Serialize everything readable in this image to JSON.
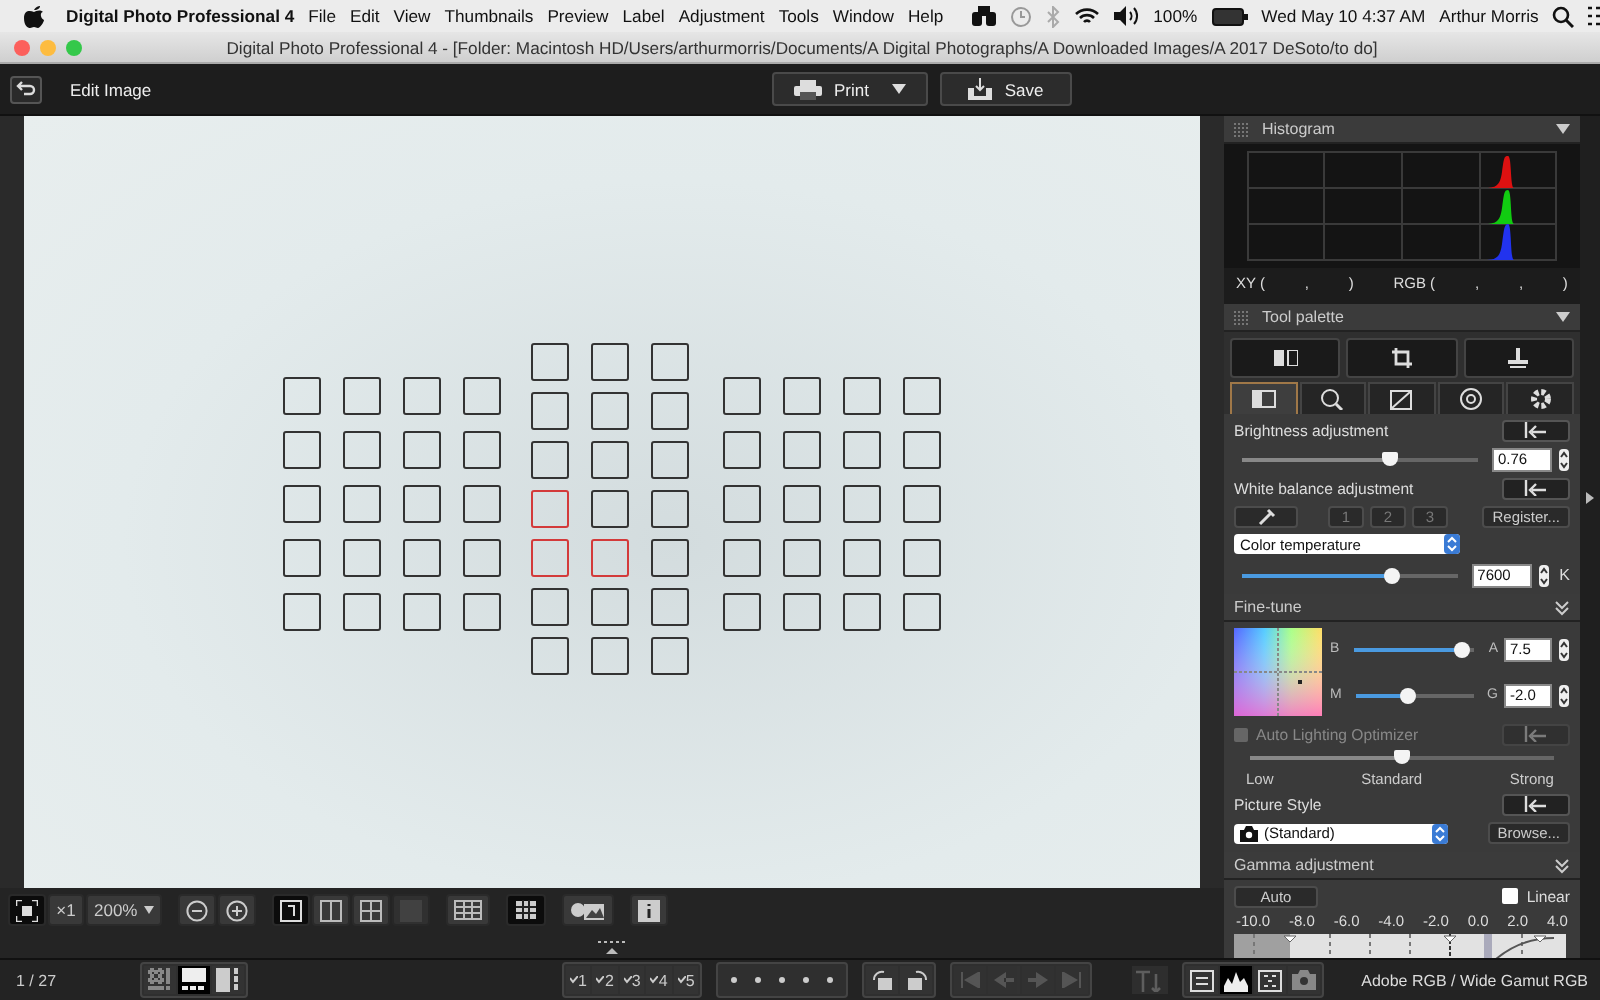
{
  "menu_bar": {
    "app_name": "Digital Photo Professional 4",
    "menus": [
      "File",
      "Edit",
      "View",
      "Thumbnails",
      "Preview",
      "Label",
      "Adjustment",
      "Tools",
      "Window",
      "Help"
    ],
    "battery": "100%",
    "clock": "Wed May 10  4:37 AM",
    "user": "Arthur Morris"
  },
  "window": {
    "title": "Digital Photo Professional 4 - [Folder: Macintosh HD/Users/arthurmorris/Documents/A Digital Photographs/A Downloaded Images/A 2017 DeSoto/to do]"
  },
  "toolbar": {
    "mode_label": "Edit Image",
    "buttons": [
      {
        "label": "Print",
        "kind": "dropdown"
      },
      {
        "label": "Save",
        "kind": "plain"
      }
    ]
  },
  "af_groups": [
    {
      "rows": [
        [
          false,
          false,
          false,
          false
        ],
        [
          false,
          false,
          false,
          false
        ],
        [
          false,
          false,
          false,
          false
        ],
        [
          false,
          false,
          false,
          false
        ],
        [
          false,
          false,
          false,
          false
        ]
      ]
    },
    {
      "rows": [
        [
          false,
          false,
          false
        ],
        [
          false,
          false,
          false
        ],
        [
          false,
          false,
          false
        ],
        [
          true,
          false,
          false
        ],
        [
          true,
          true,
          false
        ],
        [
          false,
          false,
          false
        ],
        [
          false,
          false,
          false
        ]
      ]
    },
    {
      "rows": [
        [
          false,
          false,
          false,
          false
        ],
        [
          false,
          false,
          false,
          false
        ],
        [
          false,
          false,
          false,
          false
        ],
        [
          false,
          false,
          false,
          false
        ],
        [
          false,
          false,
          false,
          false
        ]
      ]
    }
  ],
  "view_toolbar": {
    "zoom_factor": "×1",
    "zoom_level": "200%"
  },
  "histogram": {
    "title": "Histogram",
    "readout": [
      "XY (",
      ",",
      ")",
      "RGB (",
      ",",
      ",",
      ")"
    ]
  },
  "tool_palette": {
    "title": "Tool palette",
    "tabs": [
      {
        "selected": true
      },
      {
        "selected": false
      },
      {
        "selected": false
      },
      {
        "selected": false
      },
      {
        "selected": false
      }
    ]
  },
  "brightness": {
    "label": "Brightness adjustment",
    "level": 0.63,
    "value": "0.76"
  },
  "white_balance": {
    "label": "White balance adjustment",
    "presets": [
      "1",
      "2",
      "3"
    ],
    "register": "Register...",
    "mode": "Color temperature",
    "level": 0.7,
    "value": "7600",
    "unit": "K"
  },
  "fine_tune": {
    "title": "Fine-tune",
    "sliders": [
      {
        "left": "B",
        "right": "A",
        "level": 0.9,
        "value": "7.5"
      },
      {
        "left": "M",
        "right": "G",
        "level": 0.45,
        "value": "-2.0"
      }
    ]
  },
  "auto_lighting": {
    "label": "Auto Lighting Optimizer",
    "checked": false,
    "disabled": true,
    "level": 0.5,
    "scale": [
      "Low",
      "Standard",
      "Strong"
    ]
  },
  "picture_style": {
    "label": "Picture Style",
    "value": "(Standard)",
    "browse": "Browse..."
  },
  "gamma": {
    "title": "Gamma adjustment",
    "auto": "Auto",
    "linear": {
      "label": "Linear",
      "checked": false
    },
    "scale": [
      "-10.0",
      "-8.0",
      "-6.0",
      "-4.0",
      "-2.0",
      "0.0",
      "2.0",
      "4.0"
    ]
  },
  "status_bar": {
    "counter": "1 / 27",
    "layouts": [
      {
        "selected": false
      },
      {
        "selected": true
      },
      {
        "selected": false
      }
    ],
    "ratings": [
      "1",
      "2",
      "3",
      "4",
      "5"
    ],
    "panels": [
      {
        "selected": false
      },
      {
        "selected": true
      },
      {
        "selected": false
      },
      {
        "selected": false
      }
    ],
    "color_space": "Adobe RGB / Wide Gamut RGB"
  }
}
